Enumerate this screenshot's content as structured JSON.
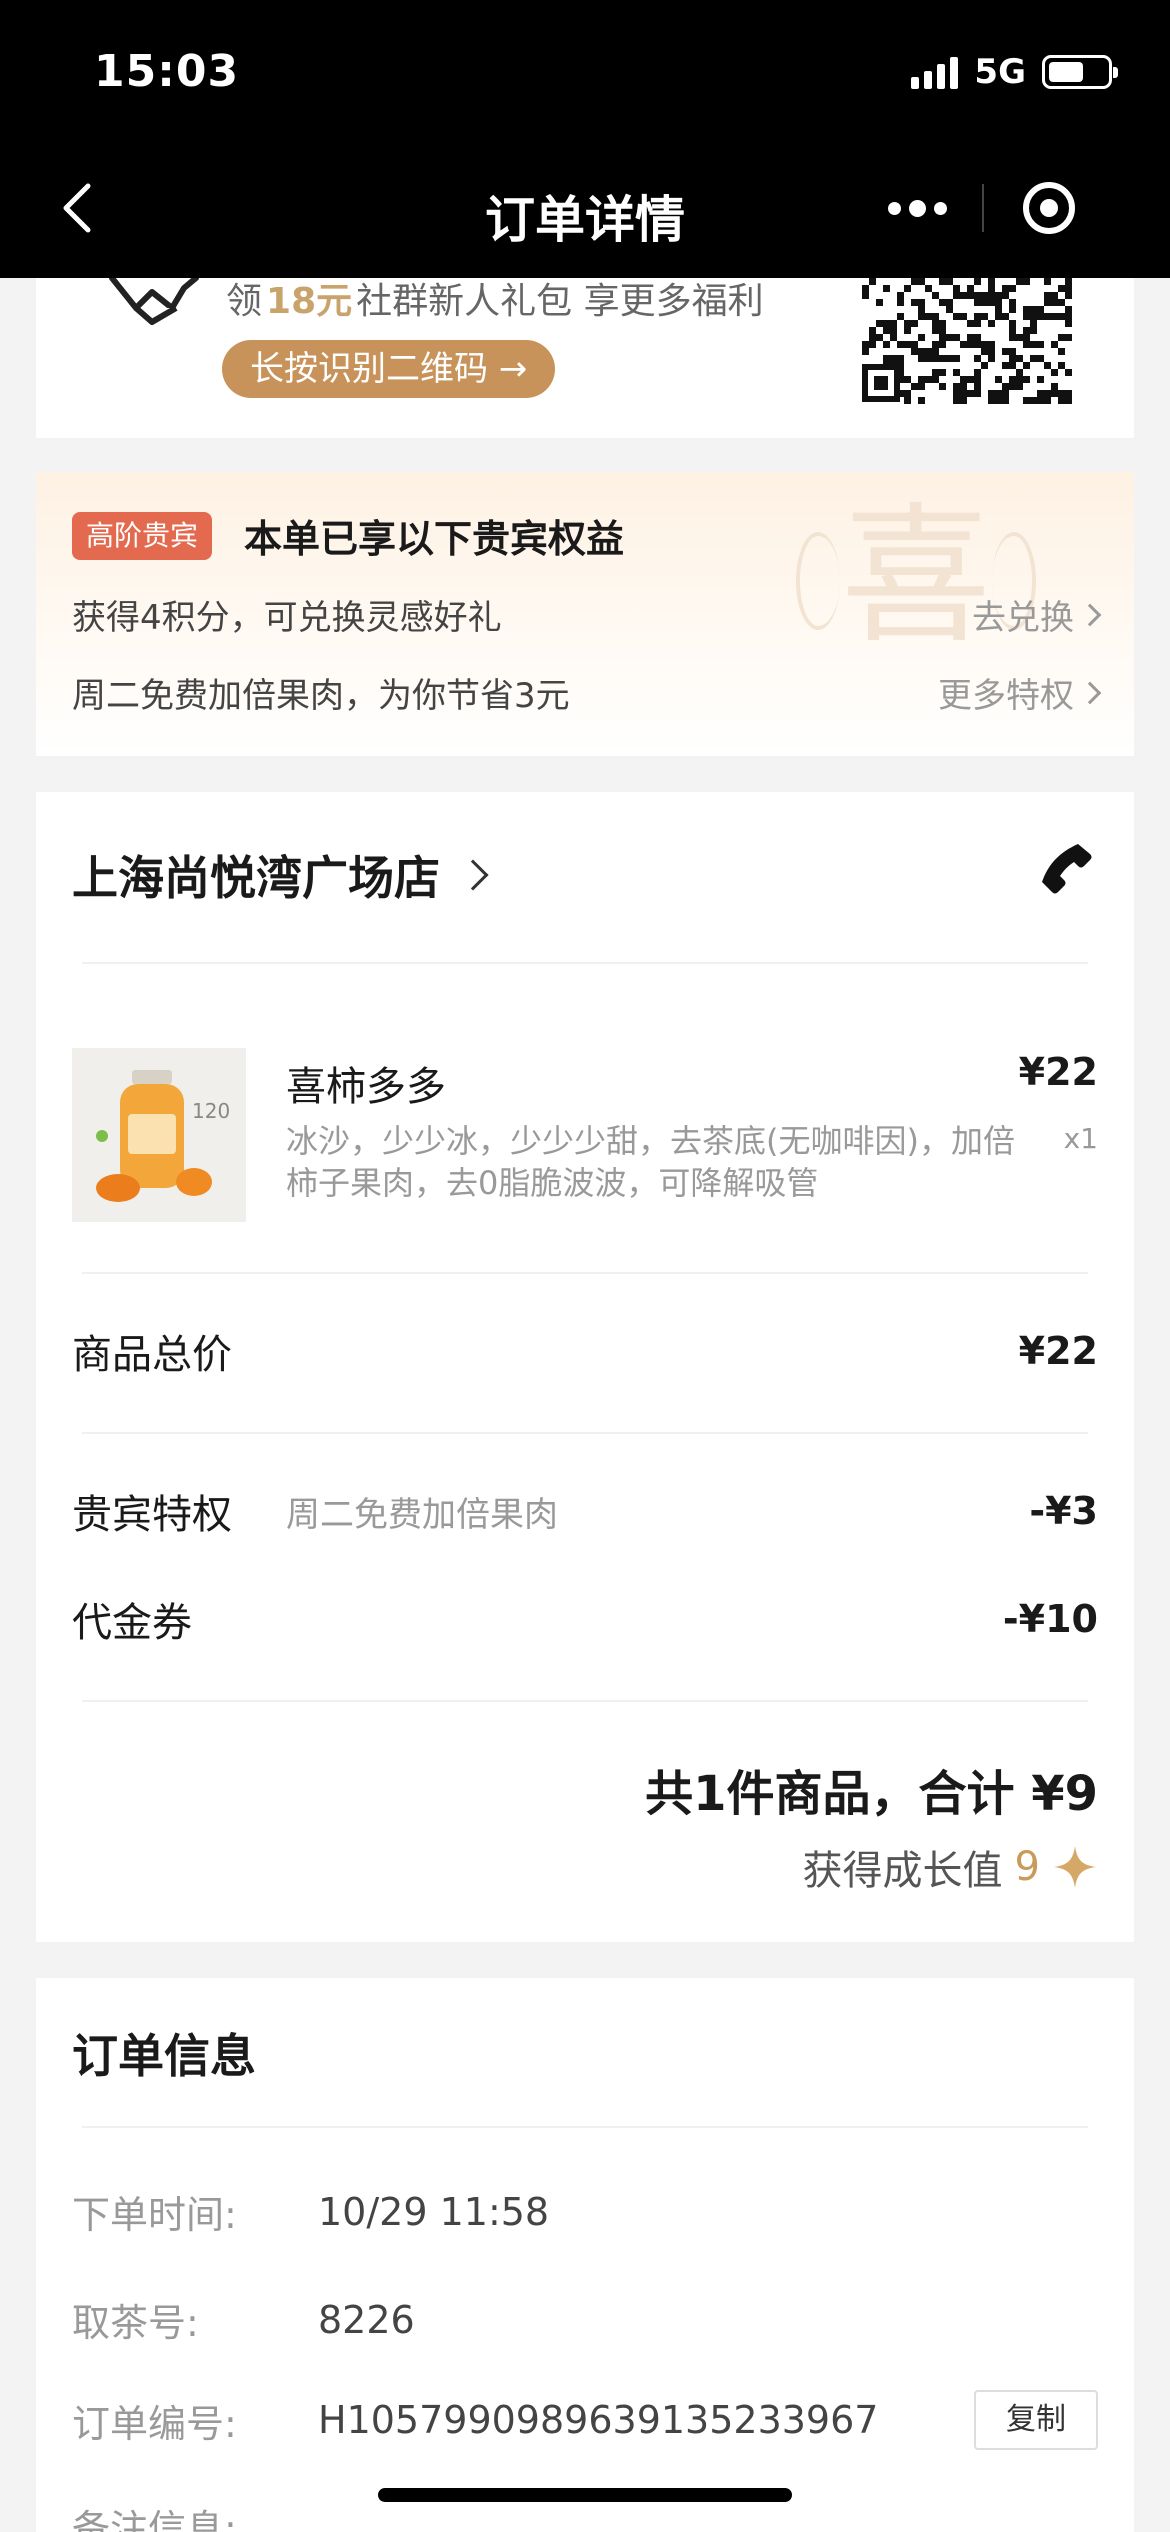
{
  "status": {
    "time": "15:03",
    "network": "5G",
    "battery_level": 0.6
  },
  "nav": {
    "title": "订单详情"
  },
  "community": {
    "text_prefix": "领",
    "amount": "18元",
    "text_suffix": "社群新人礼包 享更多福利",
    "scan_button": "长按识别二维码 →"
  },
  "vip": {
    "badge": "高阶贵宾",
    "title": "本单已享以下贵宾权益",
    "watermark": "喜",
    "rows": [
      {
        "text": "获得4积分，可兑换灵感好礼",
        "link": "去兑换"
      },
      {
        "text": "周二免费加倍果肉，为你节省3元",
        "link": "更多特权"
      }
    ]
  },
  "order": {
    "store_name": "上海尚悦湾广场店",
    "product": {
      "name": "喜柿多多",
      "price": "¥22",
      "qty": "x1",
      "spec": "冰沙，少少冰，少少少甜，去茶底(无咖啡因)，加倍柿子果肉，去0脂脆波波，可降解吸管"
    },
    "subtotal_label": "商品总价",
    "subtotal": "¥22",
    "vip_label": "贵宾特权",
    "vip_desc": "周二免费加倍果肉",
    "vip_discount": "-¥3",
    "voucher_label": "代金券",
    "voucher_discount": "-¥10",
    "total_text": "共1件商品，合计 ¥9",
    "growth_label": "获得成长值",
    "growth_value": "9"
  },
  "info": {
    "title": "订单信息",
    "order_time_label": "下单时间:",
    "order_time": "10/29 11:58",
    "pickup_label": "取茶号:",
    "pickup_no": "8226",
    "order_no_label": "订单编号:",
    "order_no": "H1057990989639135233967",
    "copy_button": "复制",
    "remark_label": "备注信息:"
  },
  "colors": {
    "accent": "#c7935a",
    "badge": "#e36a4f",
    "gold": "#c99b5a"
  }
}
